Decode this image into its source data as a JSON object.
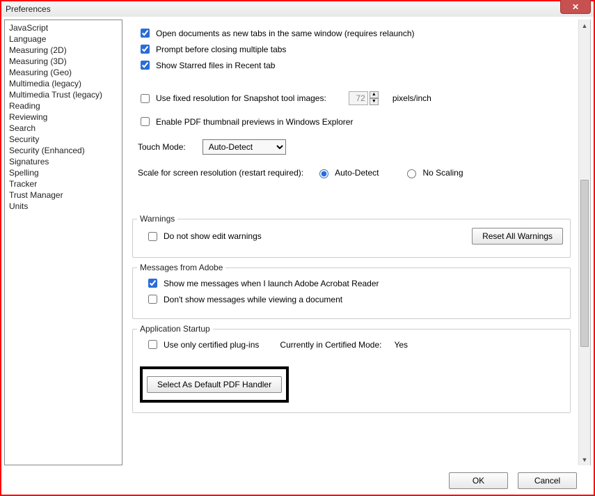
{
  "window": {
    "title": "Preferences",
    "close_symbol": "✕"
  },
  "sidebar": {
    "items": [
      "JavaScript",
      "Language",
      "Measuring (2D)",
      "Measuring (3D)",
      "Measuring (Geo)",
      "Multimedia (legacy)",
      "Multimedia Trust (legacy)",
      "Reading",
      "Reviewing",
      "Search",
      "Security",
      "Security (Enhanced)",
      "Signatures",
      "Spelling",
      "Tracker",
      "Trust Manager",
      "Units"
    ]
  },
  "general": {
    "open_tabs": "Open documents as new tabs in the same window (requires relaunch)",
    "prompt_close": "Prompt before closing multiple tabs",
    "show_starred": "Show Starred files in Recent tab",
    "fixed_res": "Use fixed resolution for Snapshot tool images:",
    "fixed_res_value": "72",
    "fixed_res_unit": "pixels/inch",
    "enable_thumb": "Enable PDF thumbnail previews in Windows Explorer",
    "touch_label": "Touch Mode:",
    "touch_value": "Auto-Detect",
    "scale_label": "Scale for screen resolution (restart required):",
    "scale_auto": "Auto-Detect",
    "scale_none": "No Scaling"
  },
  "warnings": {
    "legend": "Warnings",
    "dont_show": "Do not show edit warnings",
    "reset_btn": "Reset All Warnings"
  },
  "messages": {
    "legend": "Messages from Adobe",
    "show_launch": "Show me messages when I launch Adobe Acrobat Reader",
    "dont_view": "Don't show messages while viewing a document"
  },
  "startup": {
    "legend": "Application Startup",
    "certified": "Use only certified plug-ins",
    "mode_label": "Currently in Certified Mode:",
    "mode_value": "Yes",
    "default_handler_btn": "Select As Default PDF Handler"
  },
  "buttons": {
    "ok": "OK",
    "cancel": "Cancel"
  }
}
